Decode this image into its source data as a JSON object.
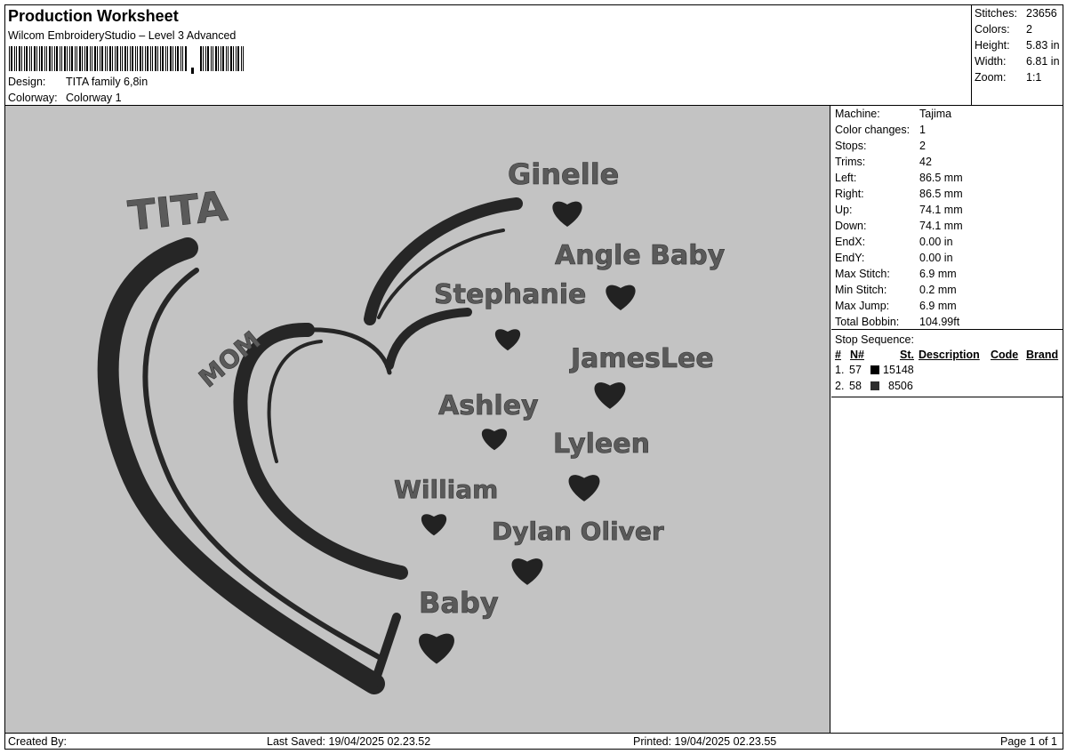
{
  "header": {
    "title": "Production Worksheet",
    "subtitle": "Wilcom EmbroideryStudio – Level 3 Advanced",
    "design_label": "Design:",
    "design_value": "TITA family 6,8in",
    "colorway_label": "Colorway:",
    "colorway_value": "Colorway 1"
  },
  "stats": [
    {
      "k": "Stitches:",
      "v": "23656"
    },
    {
      "k": "Colors:",
      "v": "2"
    },
    {
      "k": "Height:",
      "v": "5.83 in"
    },
    {
      "k": "Width:",
      "v": "6.81 in"
    },
    {
      "k": "Zoom:",
      "v": "1:1"
    }
  ],
  "machine": [
    {
      "k": "Machine:",
      "v": "Tajima"
    },
    {
      "k": "Color changes:",
      "v": "1"
    },
    {
      "k": "Stops:",
      "v": "2"
    },
    {
      "k": "Trims:",
      "v": "42"
    },
    {
      "k": "Left:",
      "v": "86.5 mm"
    },
    {
      "k": "Right:",
      "v": "86.5 mm"
    },
    {
      "k": "Up:",
      "v": "74.1 mm"
    },
    {
      "k": "Down:",
      "v": "74.1 mm"
    },
    {
      "k": "EndX:",
      "v": "0.00 in"
    },
    {
      "k": "EndY:",
      "v": "0.00 in"
    },
    {
      "k": "Max Stitch:",
      "v": "6.9 mm"
    },
    {
      "k": "Min Stitch:",
      "v": "0.2 mm"
    },
    {
      "k": "Max Jump:",
      "v": "6.9 mm"
    },
    {
      "k": "Total Bobbin:",
      "v": "104.99ft"
    }
  ],
  "stop_sequence": {
    "title": "Stop Sequence:",
    "columns": [
      "#",
      "N#",
      "St.",
      "Description",
      "Code",
      "Brand"
    ],
    "rows": [
      {
        "idx": "1.",
        "n": "57",
        "color": "#000000",
        "st": "15148"
      },
      {
        "idx": "2.",
        "n": "58",
        "color": "#2e2e2e",
        "st": "8506"
      }
    ]
  },
  "design": {
    "title_text": "TITA",
    "mom_text": "MOM",
    "names": [
      "Ginelle",
      "Angle Baby",
      "Stephanie",
      "JamesLee",
      "Ashley",
      "Lyleen",
      "William",
      "Dylan Oliver",
      "Baby"
    ]
  },
  "footer": {
    "created_by": "Created By:",
    "last_saved": "Last Saved: 19/04/2025 02.23.52",
    "printed": "Printed: 19/04/2025 02.23.55",
    "page": "Page 1 of 1"
  }
}
